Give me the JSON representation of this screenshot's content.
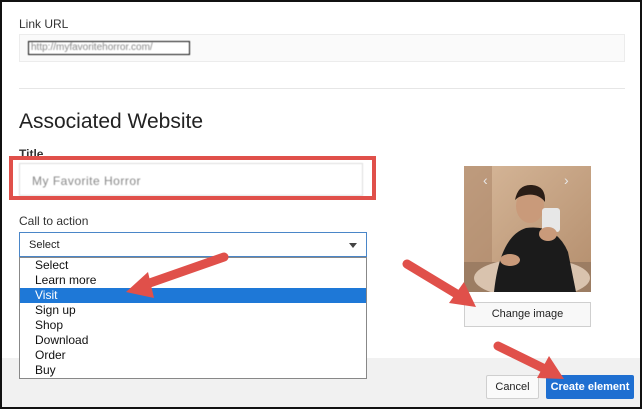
{
  "link_url": {
    "label": "Link URL",
    "value": "http://myfavoritehorror.com/"
  },
  "section": {
    "title": "Associated Website"
  },
  "title_field": {
    "label": "Title",
    "value": "My Favorite Horror"
  },
  "cta": {
    "label": "Call to action",
    "selected": "Select",
    "options": [
      "Select",
      "Learn more",
      "Visit",
      "Sign up",
      "Shop",
      "Download",
      "Order",
      "Buy"
    ],
    "highlighted_option": "Visit"
  },
  "image_panel": {
    "prev_glyph": "‹",
    "next_glyph": "›",
    "change_label": "Change image"
  },
  "footer": {
    "cancel_label": "Cancel",
    "create_label": "Create element"
  },
  "colors": {
    "highlight_red": "#e0504a",
    "primary_blue": "#1f6fd1",
    "selected_option_blue": "#1e78d7"
  },
  "icons": {
    "select_caret": "chevron-down-icon",
    "photo_prev": "chevron-left-icon",
    "photo_next": "chevron-right-icon"
  }
}
